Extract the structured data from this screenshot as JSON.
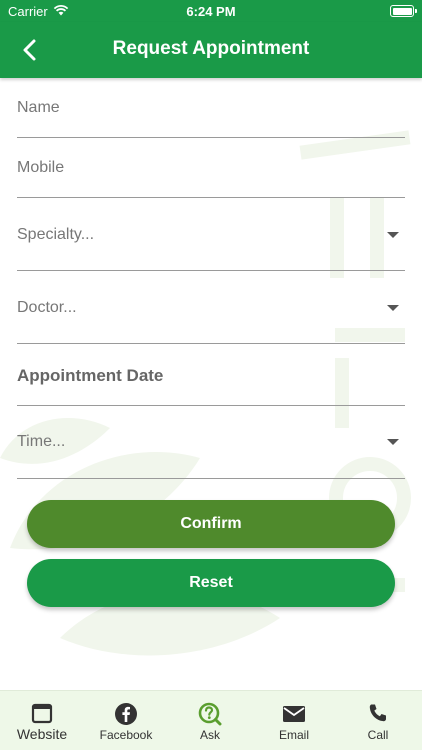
{
  "status_bar": {
    "carrier": "Carrier",
    "time": "6:24 PM"
  },
  "header": {
    "title": "Request Appointment",
    "back_icon": "chevron-left-icon"
  },
  "form": {
    "name_placeholder": "Name",
    "mobile_placeholder": "Mobile",
    "specialty_placeholder": "Specialty...",
    "doctor_placeholder": "Doctor...",
    "date_label": "Appointment Date",
    "time_placeholder": "Time..."
  },
  "buttons": {
    "confirm": "Confirm",
    "reset": "Reset"
  },
  "tabs": [
    {
      "label": "Website",
      "icon": "browser-window-icon"
    },
    {
      "label": "Facebook",
      "icon": "facebook-icon"
    },
    {
      "label": "Ask",
      "icon": "question-magnifier-icon"
    },
    {
      "label": "Email",
      "icon": "envelope-icon"
    },
    {
      "label": "Call",
      "icon": "phone-icon"
    }
  ],
  "colors": {
    "primary_green": "#1a9a48",
    "confirm_green": "#4f8a2c",
    "tab_bar_bg": "#eef8e8",
    "ask_icon_green": "#5a9e2f"
  }
}
